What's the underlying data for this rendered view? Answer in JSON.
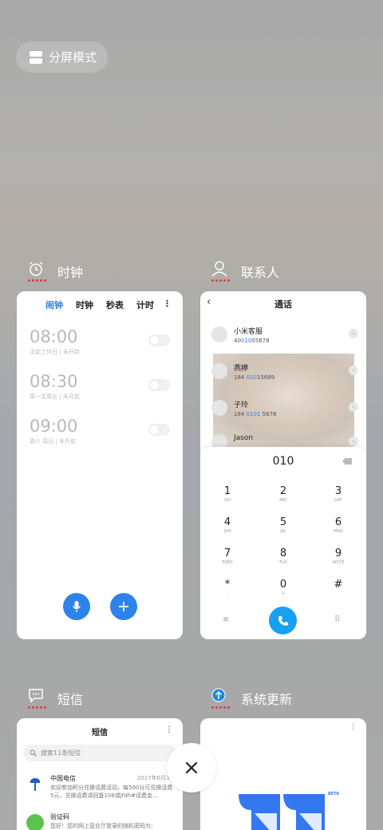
{
  "split_mode": {
    "label": "分屏模式",
    "icon": "split-screen-icon"
  },
  "clock": {
    "app_name": "时钟",
    "icon": "alarm-clock-icon",
    "tabs": [
      "闹钟",
      "时钟",
      "秒表",
      "计时"
    ],
    "active_tab": "闹钟",
    "alarms": [
      {
        "time": "08:00",
        "desc": "法定工作日 | 未开启",
        "enabled": false
      },
      {
        "time": "08:30",
        "desc": "周一至周五 | 未开启",
        "enabled": false
      },
      {
        "time": "09:00",
        "desc": "周六 周日 | 未开启",
        "enabled": false
      }
    ],
    "accent": "#2f7de1"
  },
  "contacts": {
    "app_name": "联系人",
    "icon": "person-icon",
    "header": "通话",
    "list": [
      {
        "name": "小米客服",
        "num_pre": "40",
        "num_hl": "010",
        "num_post": "05678"
      },
      {
        "name": "燕婷",
        "num_pre": "184 ",
        "num_hl": "010",
        "num_post": "15689"
      },
      {
        "name": "子玲",
        "num_pre": "184 ",
        "num_hl": "0101",
        "num_post": " 5678"
      },
      {
        "name": "Jason",
        "num_pre": "",
        "num_hl": "",
        "num_post": ""
      }
    ],
    "dialed": "010",
    "keys": [
      {
        "d": "1",
        "l": "GO"
      },
      {
        "d": "2",
        "l": "ABC"
      },
      {
        "d": "3",
        "l": "DEF"
      },
      {
        "d": "4",
        "l": "GHI"
      },
      {
        "d": "5",
        "l": "JKL"
      },
      {
        "d": "6",
        "l": "MNO"
      },
      {
        "d": "7",
        "l": "PQRS"
      },
      {
        "d": "8",
        "l": "TUV"
      },
      {
        "d": "9",
        "l": "WXYZ"
      },
      {
        "d": "*",
        "l": ","
      },
      {
        "d": "0",
        "l": "+"
      },
      {
        "d": "#",
        "l": ""
      }
    ],
    "call_color": "#18a0f2"
  },
  "sms": {
    "app_name": "短信",
    "icon": "chat-bubble-icon",
    "title": "短信",
    "search_placeholder": "搜索11条短信",
    "messages": [
      {
        "name": "中国电信",
        "date": "2017年6月30",
        "text": "欢迎参加积分兑换话费活动，每500分可兑换话费5元，兑换话费请回复106或jfdh#话费金..."
      },
      {
        "name": "验证码",
        "date": "",
        "text": "您好！您的网上营业厅登录的随机密码为："
      }
    ]
  },
  "update": {
    "app_name": "系统更新",
    "icon": "update-arrow-icon",
    "beta_label": "BETA"
  }
}
